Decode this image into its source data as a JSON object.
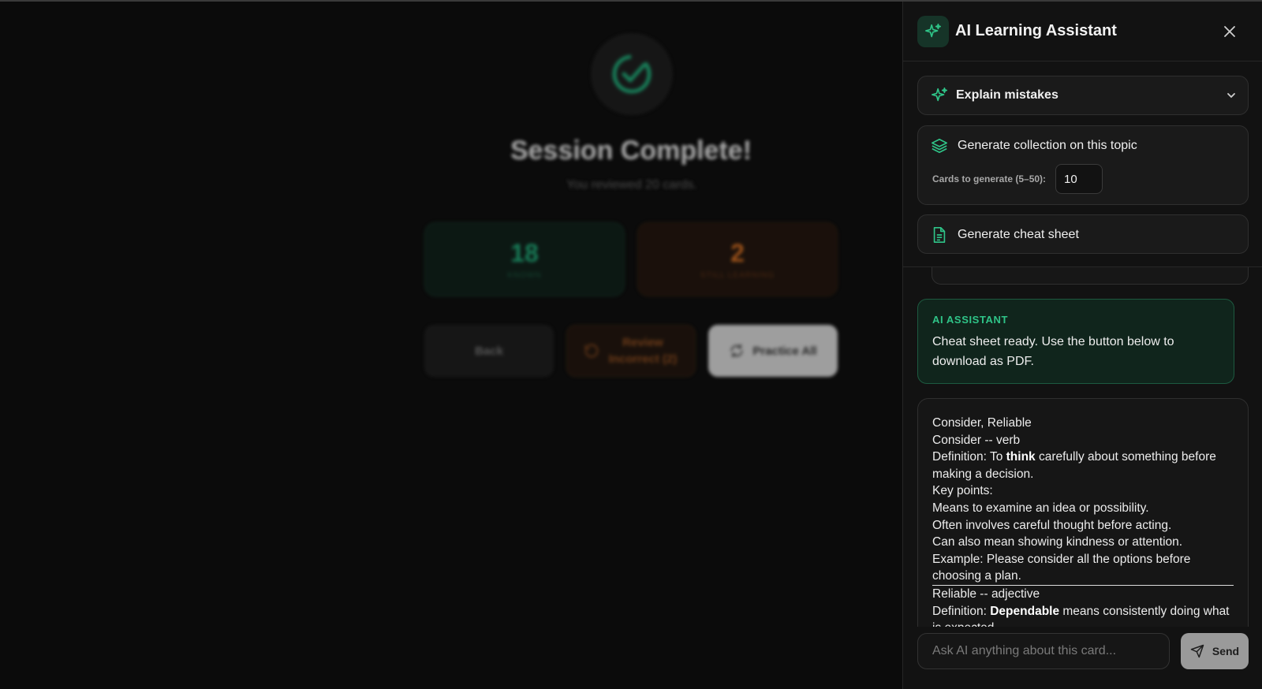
{
  "background": {
    "title": "Session Complete!",
    "subtitle": "You reviewed 20 cards.",
    "stats": [
      {
        "value": "18",
        "label": "KNOWN"
      },
      {
        "value": "2",
        "label": "STILL LEARNING"
      }
    ],
    "buttons": {
      "back": "Back",
      "review": "Review Incorrect (2)",
      "practice": "Practice All"
    }
  },
  "panel": {
    "title": "AI Learning Assistant",
    "dropdown_label": "Explain mistakes",
    "generate_collection": {
      "label": "Generate collection on this topic",
      "count_label": "Cards to generate (5–50):",
      "count_value": "10"
    },
    "cheat_sheet_label": "Generate cheat sheet",
    "messages": {
      "ai_label": "AI ASSISTANT",
      "ai_text": "Cheat sheet ready. Use the button below to download as PDF.",
      "sheet": {
        "l1": "Consider, Reliable",
        "l2": "Consider -- verb",
        "l3a": "Definition: To ",
        "l3b": "think",
        "l3c": " carefully about something before making a decision.",
        "l4": "Key points:",
        "l5": "Means to examine an idea or possibility.",
        "l6": "Often involves careful thought before acting.",
        "l7": "Can also mean showing kindness or attention.",
        "l8": "Example: Please consider all the options before choosing a plan.",
        "l9": "Reliable -- adjective",
        "l10a": "Definition: ",
        "l10b": "Dependable",
        "l10c": " means consistently doing what is expected."
      }
    },
    "composer": {
      "placeholder": "Ask AI anything about this card...",
      "send_label": "Send"
    }
  },
  "colors": {
    "accent_green": "#2fc488",
    "known_green": "#1d9e6f",
    "learning_orange": "#c4661f"
  }
}
